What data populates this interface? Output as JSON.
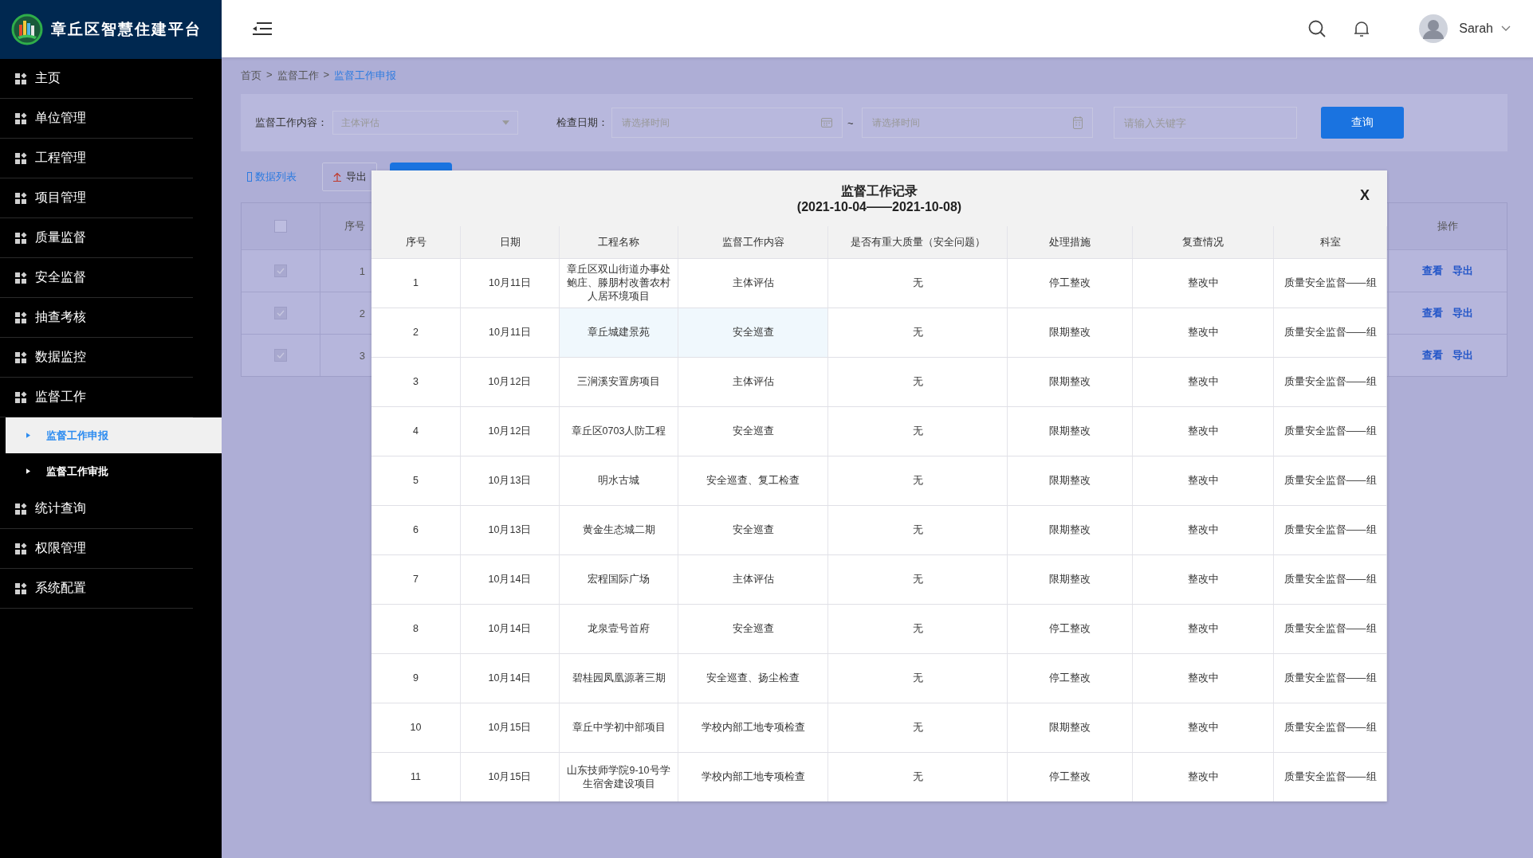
{
  "app": {
    "title": "章丘区智慧住建平台"
  },
  "sidebar": {
    "items": [
      {
        "label": "主页"
      },
      {
        "label": "单位管理"
      },
      {
        "label": "工程管理"
      },
      {
        "label": "项目管理"
      },
      {
        "label": "质量监督"
      },
      {
        "label": "安全监督"
      },
      {
        "label": "抽查考核"
      },
      {
        "label": "数据监控"
      },
      {
        "label": "监督工作",
        "children": [
          {
            "label": "监督工作申报",
            "selected": true
          },
          {
            "label": "监督工作审批",
            "selected": false
          }
        ]
      },
      {
        "label": "统计查询"
      },
      {
        "label": "权限管理"
      },
      {
        "label": "系统配置"
      }
    ]
  },
  "top_bar": {
    "user": "Sarah"
  },
  "breadcrumb": {
    "separator": ">",
    "items": [
      "首页",
      "监督工作",
      "监督工作申报"
    ]
  },
  "filters": {
    "content_label": "监督工作内容：",
    "content_placeholder": "主体评估",
    "date_label": "检查日期：",
    "date_from_placeholder": "请选择时间",
    "range_separator": "~",
    "date_to_placeholder": "请选择时间",
    "keyword_placeholder": "请输入关键字",
    "query_button": "查询"
  },
  "toolbar": {
    "list_tab": "数据列表",
    "export_button": "导出"
  },
  "background_table": {
    "all_checked": false,
    "columns": [
      "序号",
      "操作"
    ],
    "rows": [
      {
        "index": "1",
        "checked": true,
        "actions": [
          "查看",
          "导出"
        ]
      },
      {
        "index": "2",
        "checked": true,
        "actions": [
          "查看",
          "导出"
        ]
      },
      {
        "index": "3",
        "checked": true,
        "actions": [
          "查看",
          "导出"
        ]
      }
    ]
  },
  "dialog": {
    "title": "监督工作记录",
    "subtitle": "(2021-10-04——2021-10-08)",
    "close": "X",
    "columns": [
      "序号",
      "日期",
      "工程名称",
      "监督工作内容",
      "是否有重大质量（安全问题）",
      "处理措施",
      "复查情况",
      "科室"
    ],
    "rows": [
      {
        "highlighted": false,
        "cells": [
          "1",
          "10月11日",
          "章丘区双山街道办事处鲍庄、滕朋村改善农村人居环境项目",
          "主体评估",
          "无",
          "停工整改",
          "整改中",
          "质量安全监督——组"
        ]
      },
      {
        "highlighted": true,
        "cells": [
          "2",
          "10月11日",
          "章丘城建景苑",
          "安全巡查",
          "无",
          "限期整改",
          "整改中",
          "质量安全监督——组"
        ]
      },
      {
        "highlighted": false,
        "cells": [
          "3",
          "10月12日",
          "三涧溪安置房项目",
          "主体评估",
          "无",
          "限期整改",
          "整改中",
          "质量安全监督——组"
        ]
      },
      {
        "highlighted": false,
        "cells": [
          "4",
          "10月12日",
          "章丘区0703人防工程",
          "安全巡查",
          "无",
          "限期整改",
          "整改中",
          "质量安全监督——组"
        ]
      },
      {
        "highlighted": false,
        "cells": [
          "5",
          "10月13日",
          "明水古城",
          "安全巡查、复工检查",
          "无",
          "限期整改",
          "整改中",
          "质量安全监督——组"
        ]
      },
      {
        "highlighted": false,
        "cells": [
          "6",
          "10月13日",
          "黄金生态城二期",
          "安全巡查",
          "无",
          "限期整改",
          "整改中",
          "质量安全监督——组"
        ]
      },
      {
        "highlighted": false,
        "cells": [
          "7",
          "10月14日",
          "宏程国际广场",
          "主体评估",
          "无",
          "限期整改",
          "整改中",
          "质量安全监督——组"
        ]
      },
      {
        "highlighted": false,
        "cells": [
          "8",
          "10月14日",
          "龙泉壹号首府",
          "安全巡查",
          "无",
          "停工整改",
          "整改中",
          "质量安全监督——组"
        ]
      },
      {
        "highlighted": false,
        "cells": [
          "9",
          "10月14日",
          "碧桂园凤凰源著三期",
          "安全巡查、扬尘检查",
          "无",
          "停工整改",
          "整改中",
          "质量安全监督——组"
        ]
      },
      {
        "highlighted": false,
        "cells": [
          "10",
          "10月15日",
          "章丘中学初中部项目",
          "学校内部工地专项检查",
          "无",
          "限期整改",
          "整改中",
          "质量安全监督——组"
        ]
      },
      {
        "highlighted": false,
        "cells": [
          "11",
          "10月15日",
          "山东技师学院9-10号学生宿舍建设项目",
          "学校内部工地专项检查",
          "无",
          "停工整改",
          "整改中",
          "质量安全监督——组"
        ]
      }
    ]
  }
}
